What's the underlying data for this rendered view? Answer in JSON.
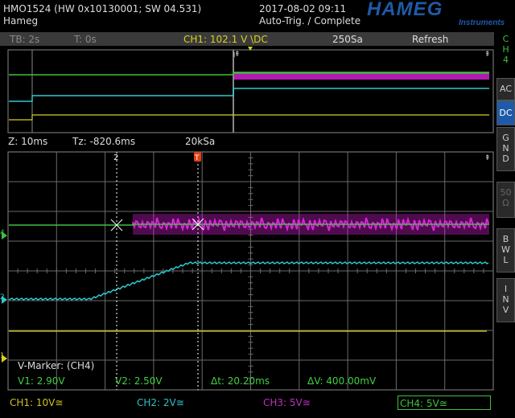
{
  "header": {
    "device": "HMO1524 (HW 0x10130001; SW 04.531)",
    "user": "Hameg",
    "datetime": "2017-08-02 09:11",
    "status": "Auto-Trig. / Complete",
    "brand": "HAMEG",
    "brand_sub": "Instruments"
  },
  "overview": {
    "tb": "TB: 2s",
    "t": "T: 0s",
    "trigger": "CH1: 102.1 V \\DC",
    "samples": "250Sa",
    "mode": "Refresh"
  },
  "zoom": {
    "z": "Z: 10ms",
    "tz": "Tz: -820.6ms",
    "rate": "20kSa"
  },
  "markers": {
    "title": "V-Marker: (CH4)",
    "v1": "V1: 2.90V",
    "v2": "V2: 2.50V",
    "dt": "Δt: 20.20ms",
    "dv": "ΔV: 400.00mV",
    "cursor1_label": "2",
    "trigger_label": "T"
  },
  "side_menu": {
    "ch4": [
      "C",
      "H",
      "4"
    ],
    "ac": "AC",
    "dc": "DC",
    "gnd": [
      "G",
      "N",
      "D"
    ],
    "ohm": [
      "50",
      "Ω"
    ],
    "bwl": [
      "B",
      "W",
      "L"
    ],
    "inv": [
      "I",
      "N",
      "V"
    ]
  },
  "channels": [
    {
      "label": "CH1: 10V≅",
      "color": "#d0c020"
    },
    {
      "label": "CH2: 2V≅",
      "color": "#30c0c8"
    },
    {
      "label": "CH3: 5V≅",
      "color": "#c030c0"
    },
    {
      "label": "CH4: 5V≅",
      "color": "#40c040"
    }
  ],
  "colors": {
    "ch1": "#d8d020",
    "ch2": "#30c8d0",
    "ch3": "#e020e0",
    "ch4": "#40c040",
    "grid": "#6a6a6a",
    "marker_text": "#40d040"
  }
}
